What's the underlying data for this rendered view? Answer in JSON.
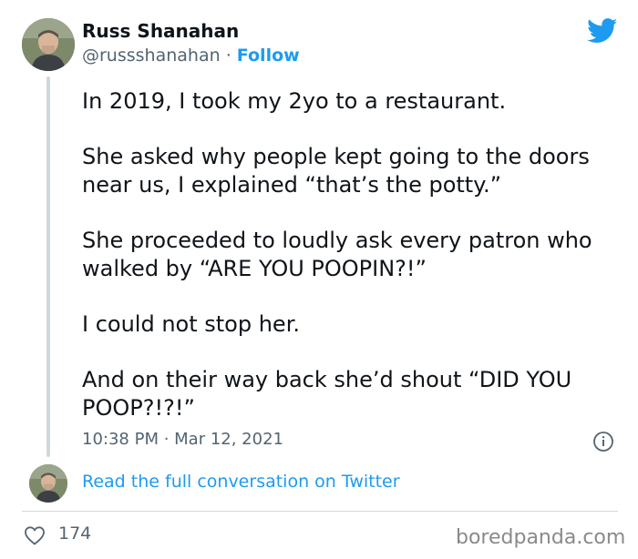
{
  "author": {
    "name": "Russ Shanahan",
    "handle": "@russshanahan",
    "separator": "·",
    "follow_label": "Follow"
  },
  "tweet": {
    "paragraphs": [
      "In 2019, I took my 2yo to a restaurant.",
      "She asked why people kept going to the doors near us, I explained “that’s the potty.”",
      "She proceeded to loudly ask every patron who walked by “ARE YOU POOPIN?!”",
      "I could not stop her.",
      "And on their way back she’d shout “DID YOU POOP?!?!”"
    ],
    "timestamp": "10:38 PM · Mar 12, 2021"
  },
  "conversation_link": "Read the full conversation on Twitter",
  "likes": "174",
  "watermark": "boredpanda.com",
  "icons": {
    "brand": "twitter-bird-icon",
    "info": "info-icon",
    "like": "heart-icon"
  },
  "colors": {
    "accent": "#1d9bf0",
    "text": "#0f1419",
    "muted": "#536471",
    "line": "#cfd9de"
  }
}
